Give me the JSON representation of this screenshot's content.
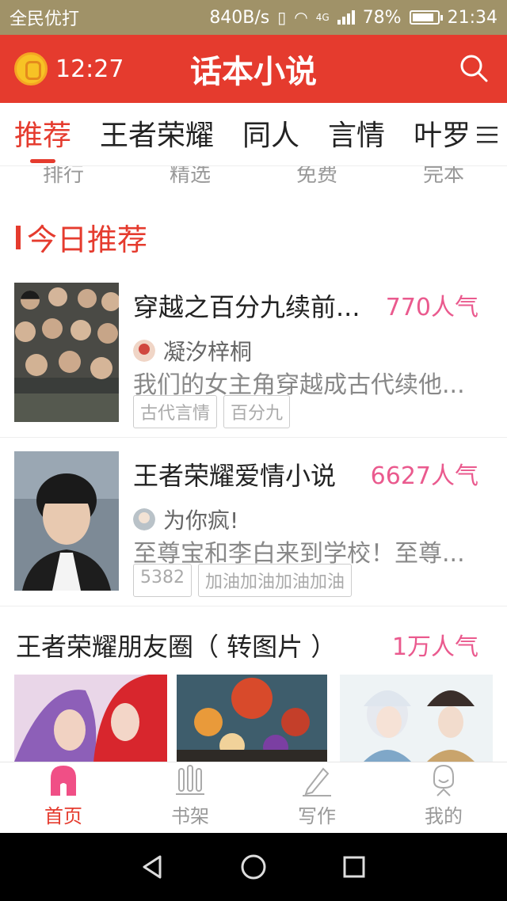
{
  "status_bar": {
    "carrier": "全民优打",
    "speed": "840B/s",
    "network": "4G",
    "battery": "78%",
    "time": "21:34"
  },
  "header": {
    "timer": "12:27",
    "title": "话本小说",
    "search_icon": "search-icon",
    "timer_icon": "coin-clock-icon"
  },
  "tabs": [
    "推荐",
    "王者荣耀",
    "同人",
    "言情",
    "叶罗"
  ],
  "subnav": [
    "排行",
    "精选",
    "免费",
    "完本"
  ],
  "section_title": "今日推荐",
  "books": [
    {
      "title": "穿越之百分九续前...",
      "popularity": "770人气",
      "author": "凝汐梓桐",
      "description": "我们的女主角穿越成古代续他...",
      "tags": [
        "古代言情",
        "百分九"
      ]
    },
    {
      "title": "王者荣耀爱情小说",
      "popularity": "6627人气",
      "author": "为你疯!",
      "description": "至尊宝和李白来到学校！至尊...",
      "tags": [
        "5382",
        "加油加油加油加油"
      ]
    }
  ],
  "gallery": {
    "title": "王者荣耀朋友圈（ 转图片 ）",
    "popularity": "1万人气"
  },
  "bottom_nav": [
    {
      "label": "首页",
      "icon": "home-icon",
      "active": true
    },
    {
      "label": "书架",
      "icon": "bookshelf-icon",
      "active": false
    },
    {
      "label": "写作",
      "icon": "pen-icon",
      "active": false
    },
    {
      "label": "我的",
      "icon": "profile-icon",
      "active": false
    }
  ],
  "colors": {
    "brand": "#e53b2e",
    "popularity": "#ea5a8e",
    "status_bar": "#a09268"
  }
}
